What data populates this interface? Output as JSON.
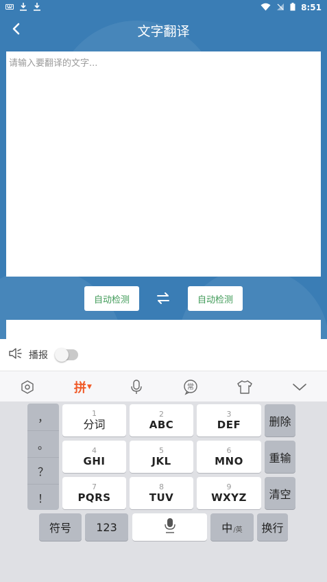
{
  "status_bar": {
    "time": "8:51"
  },
  "header": {
    "title": "文字翻译"
  },
  "input": {
    "placeholder": "请输入要翻译的文字..."
  },
  "language": {
    "source": "自动检测",
    "target": "自动检测"
  },
  "broadcast": {
    "label": "播报",
    "enabled": false
  },
  "toolbar": {
    "pinyin": "拼",
    "common_label": "常",
    "icons": [
      "settings-icon",
      "pinyin-mode",
      "microphone-icon",
      "common-phrases-icon",
      "skin-icon",
      "collapse-icon"
    ]
  },
  "keyboard": {
    "punctuation": [
      "，",
      "。",
      "？",
      "！"
    ],
    "keys": [
      {
        "num": "1",
        "text": "分词"
      },
      {
        "num": "2",
        "text": "ABC"
      },
      {
        "num": "3",
        "text": "DEF"
      },
      {
        "num": "4",
        "text": "GHI"
      },
      {
        "num": "5",
        "text": "JKL"
      },
      {
        "num": "6",
        "text": "MNO"
      },
      {
        "num": "7",
        "text": "PQRS"
      },
      {
        "num": "8",
        "text": "TUV"
      },
      {
        "num": "9",
        "text": "WXYZ"
      }
    ],
    "delete": "删除",
    "retype": "重输",
    "clear": "清空",
    "symbols": "符号",
    "numbers": "123",
    "lang_main": "中",
    "lang_sub": "/英",
    "enter": "换行"
  },
  "colors": {
    "primary": "#3a7db5",
    "accent_green": "#3f9a57",
    "accent_orange": "#f05a28"
  }
}
